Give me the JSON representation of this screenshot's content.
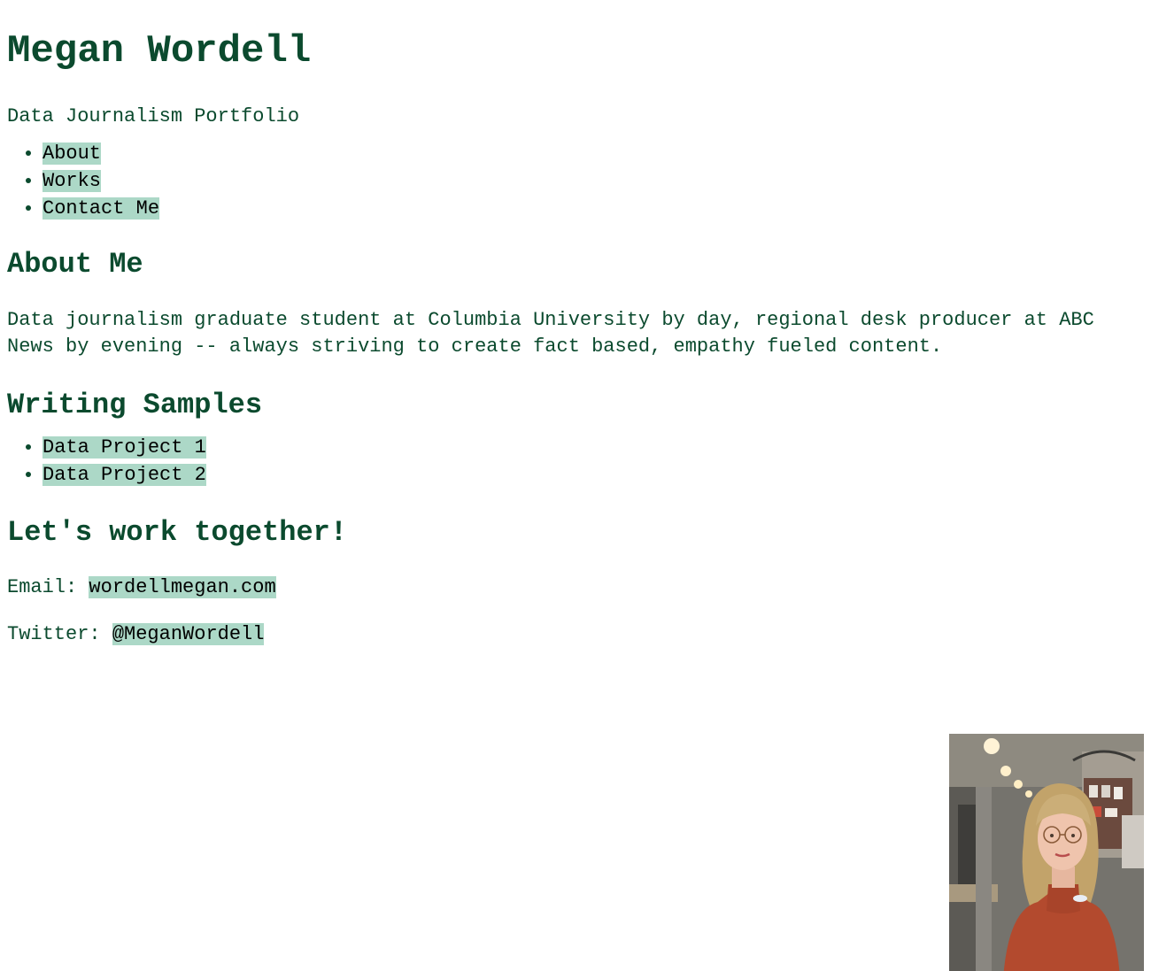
{
  "header": {
    "name": "Megan Wordell",
    "subtitle": "Data Journalism Portfolio"
  },
  "nav": {
    "items": [
      {
        "label": "About"
      },
      {
        "label": "Works"
      },
      {
        "label": "Contact Me"
      }
    ]
  },
  "about": {
    "heading": "About Me",
    "text": "Data journalism graduate student at Columbia University by day, regional desk producer at ABC News by evening -- always striving to create fact based, empathy fueled content."
  },
  "samples": {
    "heading": "Writing Samples",
    "items": [
      {
        "label": "Data Project 1"
      },
      {
        "label": "Data Project 2"
      }
    ]
  },
  "contact": {
    "heading": "Let's work together!",
    "email_label": "Email: ",
    "email_value": "wordellmegan.com",
    "twitter_label": "Twitter: ",
    "twitter_value": "@MeganWordell"
  },
  "colors": {
    "text": "#0b4a2e",
    "link_highlight": "#acd8c7",
    "link_text": "#000000",
    "background": "#ffffff"
  }
}
